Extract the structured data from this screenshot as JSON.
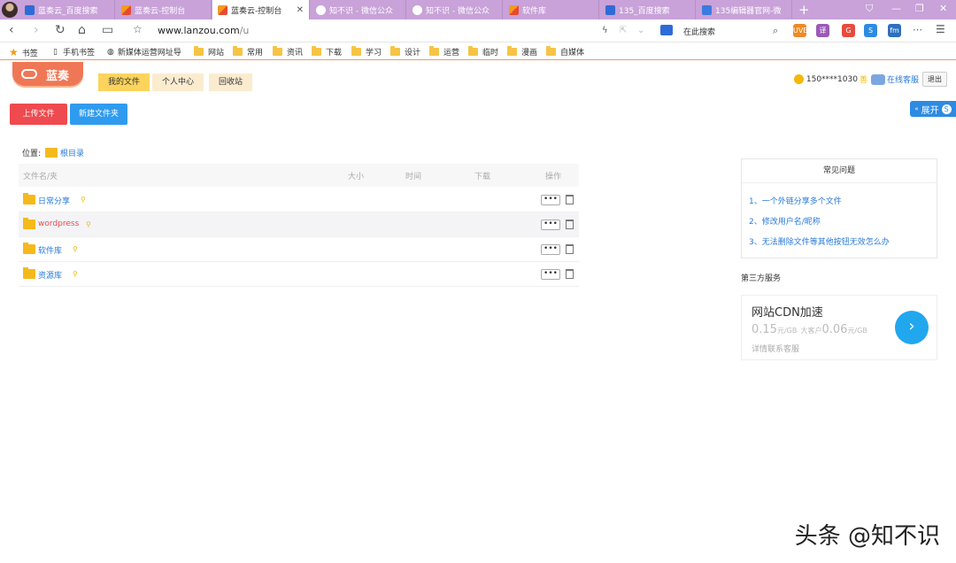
{
  "browser": {
    "tabs": [
      {
        "label": "蓝奏云_百度搜索",
        "icon": "baidu-paw-icon",
        "active": false
      },
      {
        "label": "蓝奏云-控制台",
        "icon": "lanzou-icon",
        "active": false
      },
      {
        "label": "蓝奏云-控制台",
        "icon": "lanzou-icon",
        "active": true
      },
      {
        "label": "知不识 - 微信公众",
        "icon": "wechat-icon",
        "active": false
      },
      {
        "label": "知不识 - 微信公众",
        "icon": "wechat-icon",
        "active": false
      },
      {
        "label": "软件库",
        "icon": "lanzou-icon",
        "active": false
      },
      {
        "label": "135_百度搜索",
        "icon": "baidu-paw-icon",
        "active": false
      },
      {
        "label": "135编辑器官网-微",
        "icon": "editor135-icon",
        "active": false
      }
    ],
    "close_glyph": "✕",
    "new_tab_glyph": "+",
    "url_host": "www.lanzou.com",
    "url_path": "/u",
    "search_placeholder": "在此搜索",
    "bookmarks": [
      {
        "label": "书签",
        "icon": "star-icon"
      },
      {
        "label": "手机书签",
        "icon": "phone-icon"
      },
      {
        "label": "新媒体运营网址导",
        "icon": "globe-icon"
      },
      {
        "label": "网站",
        "icon": "folder-icon"
      },
      {
        "label": "常用",
        "icon": "folder-icon"
      },
      {
        "label": "资讯",
        "icon": "folder-icon"
      },
      {
        "label": "下载",
        "icon": "folder-icon"
      },
      {
        "label": "学习",
        "icon": "folder-icon"
      },
      {
        "label": "设计",
        "icon": "folder-icon"
      },
      {
        "label": "运营",
        "icon": "folder-icon"
      },
      {
        "label": "临时",
        "icon": "folder-icon"
      },
      {
        "label": "漫画",
        "icon": "folder-icon"
      },
      {
        "label": "自媒体",
        "icon": "folder-icon"
      }
    ],
    "extensions": [
      {
        "label": "UVE",
        "color": "#f08a24"
      },
      {
        "label": "译",
        "color": "#9b59b6"
      },
      {
        "label": "G",
        "color": "#e74c3c"
      },
      {
        "label": "S",
        "color": "#2d8be2"
      },
      {
        "label": "fm",
        "color": "#2f6fbf"
      }
    ]
  },
  "site": {
    "logo_text": "蓝奏",
    "nav_tabs": [
      "我的文件",
      "个人中心",
      "回收站"
    ],
    "user": {
      "phone": "150****1030",
      "coin_glyph": "善",
      "support_label": "在线客服",
      "logout_label": "退出"
    },
    "expand_label": "展开",
    "buttons": {
      "upload": "上传文件",
      "new_folder": "新建文件夹"
    },
    "location_label": "位置:",
    "root_label": "根目录",
    "table": {
      "headers": [
        "文件名/夹",
        "大小",
        "时间",
        "下载",
        "操作"
      ],
      "rows": [
        {
          "name": "日常分享",
          "highlighted": false
        },
        {
          "name": "wordpress",
          "highlighted": true
        },
        {
          "name": "软件库",
          "highlighted": false
        },
        {
          "name": "资源库",
          "highlighted": false
        }
      ],
      "more_glyph": "•••"
    },
    "faq": {
      "title": "常见问题",
      "items": [
        "1、一个外链分享多个文件",
        "2、修改用户名/昵称",
        "3、无法删除文件等其他按钮无效怎么办"
      ]
    },
    "third_party_title": "第三方服务",
    "cdn": {
      "title": "网站CDN加速",
      "price1": "0.15",
      "unit1": "元/GB",
      "mid": "大客户",
      "price2": "0.06",
      "unit2": "元/GB",
      "note": "详情联系客服",
      "arrow": "›"
    }
  },
  "watermark": "头条 @知不识"
}
